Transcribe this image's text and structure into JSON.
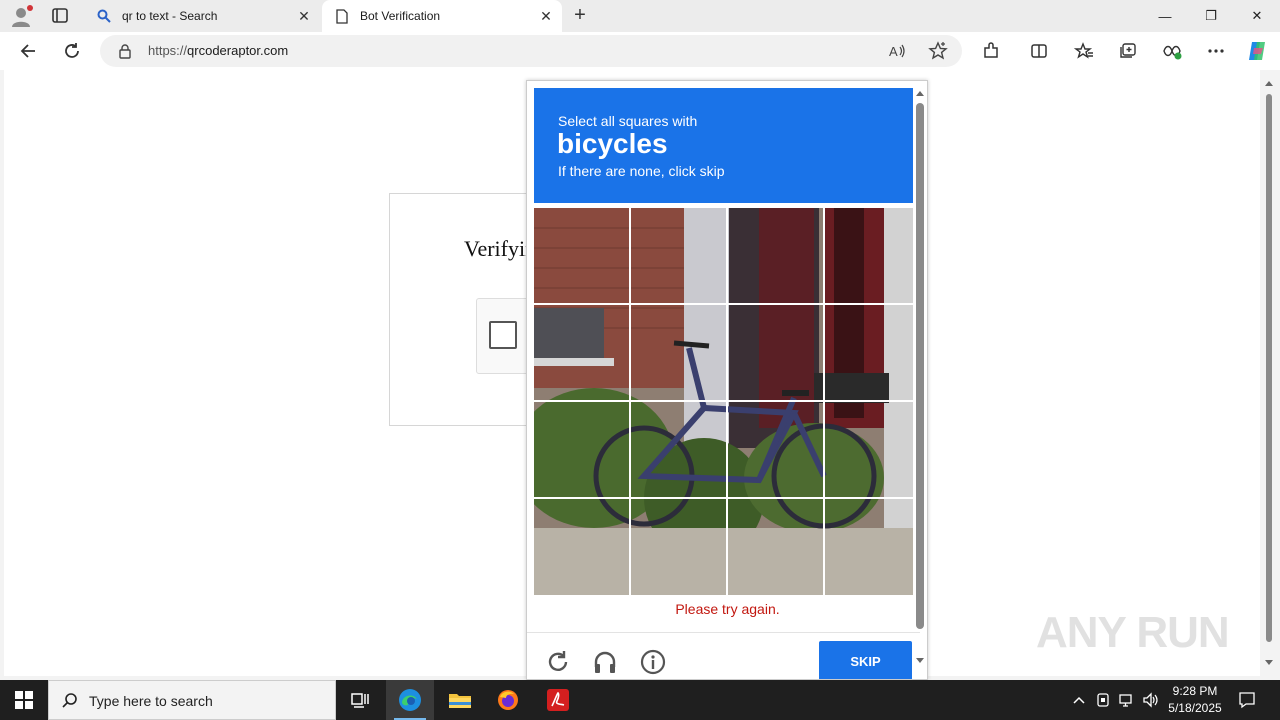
{
  "browser": {
    "tabs": [
      {
        "title": "qr to text - Search",
        "active": false,
        "icon": "search-icon"
      },
      {
        "title": "Bot Verification",
        "active": true,
        "icon": "page-icon"
      }
    ],
    "url_scheme": "https://",
    "url_host": "qrcoderaptor.com"
  },
  "page": {
    "verify_title": "Verifying you are human"
  },
  "captcha": {
    "instruction": "Select all squares with",
    "target": "bicycles",
    "hint": "If there are none, click skip",
    "error": "Please try again.",
    "skip_label": "SKIP",
    "grid_rows": 4,
    "grid_cols": 4
  },
  "taskbar": {
    "search_placeholder": "Type here to search",
    "time": "9:28 PM",
    "date": "5/18/2025"
  },
  "watermark": "ANY RUN",
  "colors": {
    "captcha_blue": "#1a73e8",
    "error_red": "#c2170f",
    "taskbar": "#1f1f1f"
  }
}
